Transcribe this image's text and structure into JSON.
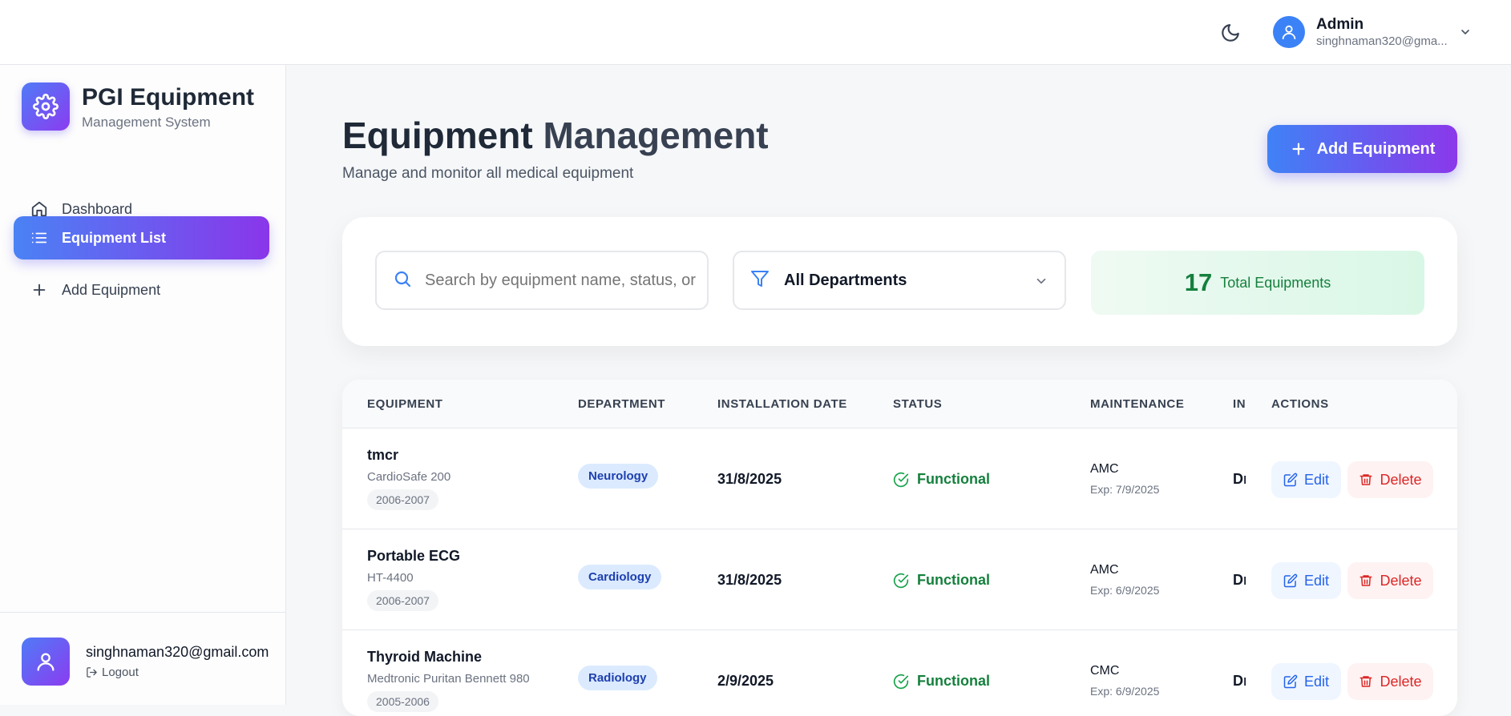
{
  "header": {
    "theme_toggle_icon": "moon-icon",
    "user": {
      "name": "Admin",
      "email": "singhnaman320@gma..."
    }
  },
  "sidebar": {
    "brand": {
      "title": "PGI Equipment",
      "subtitle": "Management System",
      "icon": "gear-icon"
    },
    "items": [
      {
        "label": "Dashboard",
        "icon": "home-icon",
        "active": false
      },
      {
        "label": "Equipment List",
        "icon": "list-icon",
        "active": true
      },
      {
        "label": "Add Equipment",
        "icon": "plus-icon",
        "active": false
      }
    ],
    "footer": {
      "email": "singhnaman320@gmail.com",
      "logout": "Logout"
    }
  },
  "main": {
    "title_part1": "Equipment ",
    "title_part2": "Management",
    "subtitle": "Manage and monitor all medical equipment",
    "add_button": "Add Equipment",
    "filters": {
      "search_placeholder": "Search by equipment name, status, or",
      "department_value": "All Departments",
      "total_count": "17",
      "total_label": "Total Equipments"
    },
    "table": {
      "headers": [
        "EQUIPMENT",
        "DEPARTMENT",
        "INSTALLATION DATE",
        "STATUS",
        "MAINTENANCE",
        "IN",
        "ACTIONS"
      ],
      "rows": [
        {
          "name": "tmcr",
          "model": "CardioSafe 200",
          "year": "2006-2007",
          "department": "Neurology",
          "installation": "31/8/2025",
          "status": "Functional",
          "maint_type": "AMC",
          "maint_exp": "Exp: 7/9/2025",
          "in": "Dr"
        },
        {
          "name": "Portable ECG",
          "model": "HT-4400",
          "year": "2006-2007",
          "department": "Cardiology",
          "installation": "31/8/2025",
          "status": "Functional",
          "maint_type": "AMC",
          "maint_exp": "Exp: 6/9/2025",
          "in": "Dr"
        },
        {
          "name": "Thyroid Machine",
          "model": "Medtronic Puritan Bennett 980",
          "year": "2005-2006",
          "department": "Radiology",
          "installation": "2/9/2025",
          "status": "Functional",
          "maint_type": "CMC",
          "maint_exp": "Exp: 6/9/2025",
          "in": "Dr"
        }
      ],
      "edit_label": "Edit",
      "delete_label": "Delete"
    }
  },
  "colors": {
    "accent_start": "#3f82f6",
    "accent_end": "#8b38ea",
    "success": "#15803d",
    "danger": "#dc2626"
  }
}
